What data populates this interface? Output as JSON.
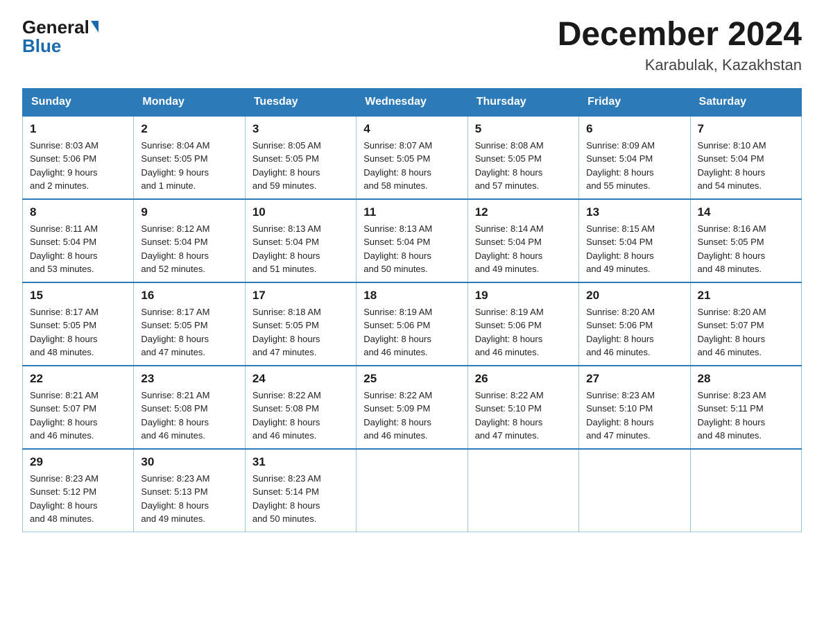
{
  "header": {
    "logo_general": "General",
    "logo_blue": "Blue",
    "main_title": "December 2024",
    "subtitle": "Karabulak, Kazakhstan"
  },
  "calendar": {
    "days_of_week": [
      "Sunday",
      "Monday",
      "Tuesday",
      "Wednesday",
      "Thursday",
      "Friday",
      "Saturday"
    ],
    "weeks": [
      [
        {
          "day": "1",
          "sunrise": "8:03 AM",
          "sunset": "5:06 PM",
          "daylight": "9 hours and 2 minutes."
        },
        {
          "day": "2",
          "sunrise": "8:04 AM",
          "sunset": "5:05 PM",
          "daylight": "9 hours and 1 minute."
        },
        {
          "day": "3",
          "sunrise": "8:05 AM",
          "sunset": "5:05 PM",
          "daylight": "8 hours and 59 minutes."
        },
        {
          "day": "4",
          "sunrise": "8:07 AM",
          "sunset": "5:05 PM",
          "daylight": "8 hours and 58 minutes."
        },
        {
          "day": "5",
          "sunrise": "8:08 AM",
          "sunset": "5:05 PM",
          "daylight": "8 hours and 57 minutes."
        },
        {
          "day": "6",
          "sunrise": "8:09 AM",
          "sunset": "5:04 PM",
          "daylight": "8 hours and 55 minutes."
        },
        {
          "day": "7",
          "sunrise": "8:10 AM",
          "sunset": "5:04 PM",
          "daylight": "8 hours and 54 minutes."
        }
      ],
      [
        {
          "day": "8",
          "sunrise": "8:11 AM",
          "sunset": "5:04 PM",
          "daylight": "8 hours and 53 minutes."
        },
        {
          "day": "9",
          "sunrise": "8:12 AM",
          "sunset": "5:04 PM",
          "daylight": "8 hours and 52 minutes."
        },
        {
          "day": "10",
          "sunrise": "8:13 AM",
          "sunset": "5:04 PM",
          "daylight": "8 hours and 51 minutes."
        },
        {
          "day": "11",
          "sunrise": "8:13 AM",
          "sunset": "5:04 PM",
          "daylight": "8 hours and 50 minutes."
        },
        {
          "day": "12",
          "sunrise": "8:14 AM",
          "sunset": "5:04 PM",
          "daylight": "8 hours and 49 minutes."
        },
        {
          "day": "13",
          "sunrise": "8:15 AM",
          "sunset": "5:04 PM",
          "daylight": "8 hours and 49 minutes."
        },
        {
          "day": "14",
          "sunrise": "8:16 AM",
          "sunset": "5:05 PM",
          "daylight": "8 hours and 48 minutes."
        }
      ],
      [
        {
          "day": "15",
          "sunrise": "8:17 AM",
          "sunset": "5:05 PM",
          "daylight": "8 hours and 48 minutes."
        },
        {
          "day": "16",
          "sunrise": "8:17 AM",
          "sunset": "5:05 PM",
          "daylight": "8 hours and 47 minutes."
        },
        {
          "day": "17",
          "sunrise": "8:18 AM",
          "sunset": "5:05 PM",
          "daylight": "8 hours and 47 minutes."
        },
        {
          "day": "18",
          "sunrise": "8:19 AM",
          "sunset": "5:06 PM",
          "daylight": "8 hours and 46 minutes."
        },
        {
          "day": "19",
          "sunrise": "8:19 AM",
          "sunset": "5:06 PM",
          "daylight": "8 hours and 46 minutes."
        },
        {
          "day": "20",
          "sunrise": "8:20 AM",
          "sunset": "5:06 PM",
          "daylight": "8 hours and 46 minutes."
        },
        {
          "day": "21",
          "sunrise": "8:20 AM",
          "sunset": "5:07 PM",
          "daylight": "8 hours and 46 minutes."
        }
      ],
      [
        {
          "day": "22",
          "sunrise": "8:21 AM",
          "sunset": "5:07 PM",
          "daylight": "8 hours and 46 minutes."
        },
        {
          "day": "23",
          "sunrise": "8:21 AM",
          "sunset": "5:08 PM",
          "daylight": "8 hours and 46 minutes."
        },
        {
          "day": "24",
          "sunrise": "8:22 AM",
          "sunset": "5:08 PM",
          "daylight": "8 hours and 46 minutes."
        },
        {
          "day": "25",
          "sunrise": "8:22 AM",
          "sunset": "5:09 PM",
          "daylight": "8 hours and 46 minutes."
        },
        {
          "day": "26",
          "sunrise": "8:22 AM",
          "sunset": "5:10 PM",
          "daylight": "8 hours and 47 minutes."
        },
        {
          "day": "27",
          "sunrise": "8:23 AM",
          "sunset": "5:10 PM",
          "daylight": "8 hours and 47 minutes."
        },
        {
          "day": "28",
          "sunrise": "8:23 AM",
          "sunset": "5:11 PM",
          "daylight": "8 hours and 48 minutes."
        }
      ],
      [
        {
          "day": "29",
          "sunrise": "8:23 AM",
          "sunset": "5:12 PM",
          "daylight": "8 hours and 48 minutes."
        },
        {
          "day": "30",
          "sunrise": "8:23 AM",
          "sunset": "5:13 PM",
          "daylight": "8 hours and 49 minutes."
        },
        {
          "day": "31",
          "sunrise": "8:23 AM",
          "sunset": "5:14 PM",
          "daylight": "8 hours and 50 minutes."
        },
        null,
        null,
        null,
        null
      ]
    ]
  }
}
